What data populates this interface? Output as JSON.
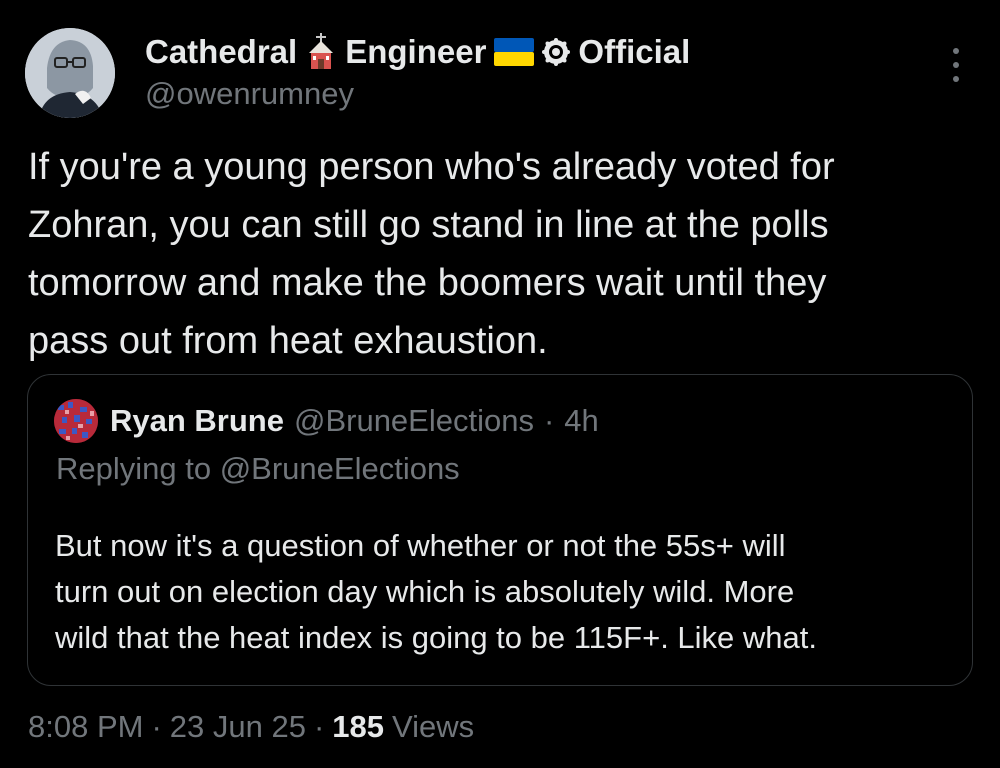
{
  "author": {
    "name_part1": "Cathedral",
    "name_part2": "Engineer",
    "name_part3": "Official",
    "handle": "@owenrumney"
  },
  "icons": {
    "church": "church-icon",
    "flag": "ukraine-flag-icon",
    "badge": "verified-badge-icon",
    "more": "more-options-icon"
  },
  "tweet": {
    "lines": [
      "If you're a young person who's already voted for",
      "Zohran, you can still go stand in line at the polls",
      "tomorrow and make the boomers wait until they",
      "pass out from heat exhaustion."
    ]
  },
  "quote": {
    "name": "Ryan Brune",
    "handle": "@BruneElections",
    "separator": "·",
    "age": "4h",
    "replying_to": "Replying to @BruneElections",
    "lines": [
      "But now it's a question of whether or not the 55s+ will",
      "turn out on election day which is absolutely wild. More",
      "wild that the heat index is going to be 115F+. Like what."
    ]
  },
  "footer": {
    "time": "8:08 PM",
    "sep1": "·",
    "date": "23 Jun 25",
    "sep2": "·",
    "views_count": "185",
    "views_label": "Views"
  },
  "colors": {
    "background": "#000000",
    "text": "#e7e9ea",
    "muted": "#71767b",
    "border": "#2f3336",
    "flag_blue": "#0057b7",
    "flag_yellow": "#ffd700"
  }
}
